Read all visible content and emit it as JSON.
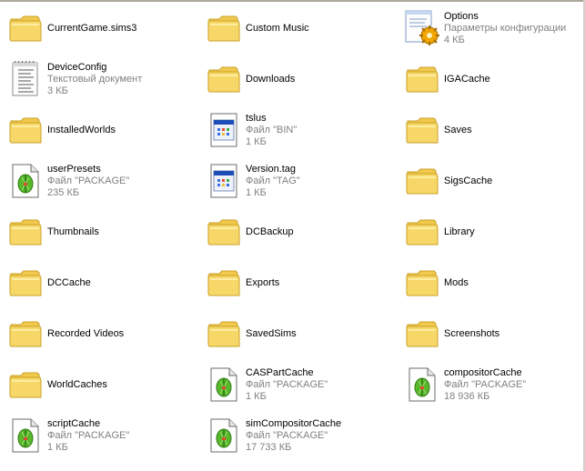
{
  "window": {
    "view": "Tiles"
  },
  "items": [
    {
      "name": "CurrentGame.sims3",
      "type": "folder",
      "icon": "folder-icon",
      "lines": []
    },
    {
      "name": "Custom Music",
      "type": "folder",
      "icon": "folder-icon",
      "lines": []
    },
    {
      "name": "Options",
      "type": "config",
      "icon": "config-file-icon",
      "lines": [
        "Параметры конфигурации",
        "4 КБ"
      ]
    },
    {
      "name": "DeviceConfig",
      "type": "text",
      "icon": "text-document-icon",
      "lines": [
        "Текстовый документ",
        "3 КБ"
      ]
    },
    {
      "name": "Downloads",
      "type": "folder",
      "icon": "folder-icon",
      "lines": []
    },
    {
      "name": "IGACache",
      "type": "folder",
      "icon": "folder-icon",
      "lines": []
    },
    {
      "name": "InstalledWorlds",
      "type": "folder",
      "icon": "folder-icon",
      "lines": []
    },
    {
      "name": "tslus",
      "type": "generic",
      "icon": "generic-file-icon",
      "lines": [
        "Файл \"BIN\"",
        "1 КБ"
      ]
    },
    {
      "name": "Saves",
      "type": "folder",
      "icon": "folder-icon",
      "lines": []
    },
    {
      "name": "userPresets",
      "type": "package",
      "icon": "sims-package-icon",
      "lines": [
        "Файл \"PACKAGE\"",
        "235 КБ"
      ]
    },
    {
      "name": "Version.tag",
      "type": "generic",
      "icon": "generic-file-icon",
      "lines": [
        "Файл \"TAG\"",
        "1 КБ"
      ]
    },
    {
      "name": "SigsCache",
      "type": "folder",
      "icon": "folder-icon",
      "lines": []
    },
    {
      "name": "Thumbnails",
      "type": "folder",
      "icon": "folder-icon",
      "lines": []
    },
    {
      "name": "DCBackup",
      "type": "folder",
      "icon": "folder-icon",
      "lines": []
    },
    {
      "name": "Library",
      "type": "folder",
      "icon": "folder-icon",
      "lines": []
    },
    {
      "name": "DCCache",
      "type": "folder",
      "icon": "folder-icon",
      "lines": []
    },
    {
      "name": "Exports",
      "type": "folder",
      "icon": "folder-icon",
      "lines": []
    },
    {
      "name": "Mods",
      "type": "folder",
      "icon": "folder-icon",
      "lines": []
    },
    {
      "name": "Recorded Videos",
      "type": "folder",
      "icon": "folder-icon",
      "lines": []
    },
    {
      "name": "SavedSims",
      "type": "folder",
      "icon": "folder-icon",
      "lines": []
    },
    {
      "name": "Screenshots",
      "type": "folder",
      "icon": "folder-icon",
      "lines": []
    },
    {
      "name": "WorldCaches",
      "type": "folder",
      "icon": "folder-icon",
      "lines": []
    },
    {
      "name": "CASPartCache",
      "type": "package",
      "icon": "sims-package-icon",
      "lines": [
        "Файл \"PACKAGE\"",
        "1 КБ"
      ]
    },
    {
      "name": "compositorCache",
      "type": "package",
      "icon": "sims-package-icon",
      "lines": [
        "Файл \"PACKAGE\"",
        "18 936 КБ"
      ]
    },
    {
      "name": "scriptCache",
      "type": "package",
      "icon": "sims-package-icon",
      "lines": [
        "Файл \"PACKAGE\"",
        "1 КБ"
      ]
    },
    {
      "name": "simCompositorCache",
      "type": "package",
      "icon": "sims-package-icon",
      "lines": [
        "Файл \"PACKAGE\"",
        "17 733 КБ"
      ]
    }
  ],
  "colors": {
    "folder_fill": "#f7d768",
    "folder_light": "#fff3b0",
    "folder_edge": "#c9a227",
    "selection": "#316ac5",
    "detail_text": "#808080"
  }
}
